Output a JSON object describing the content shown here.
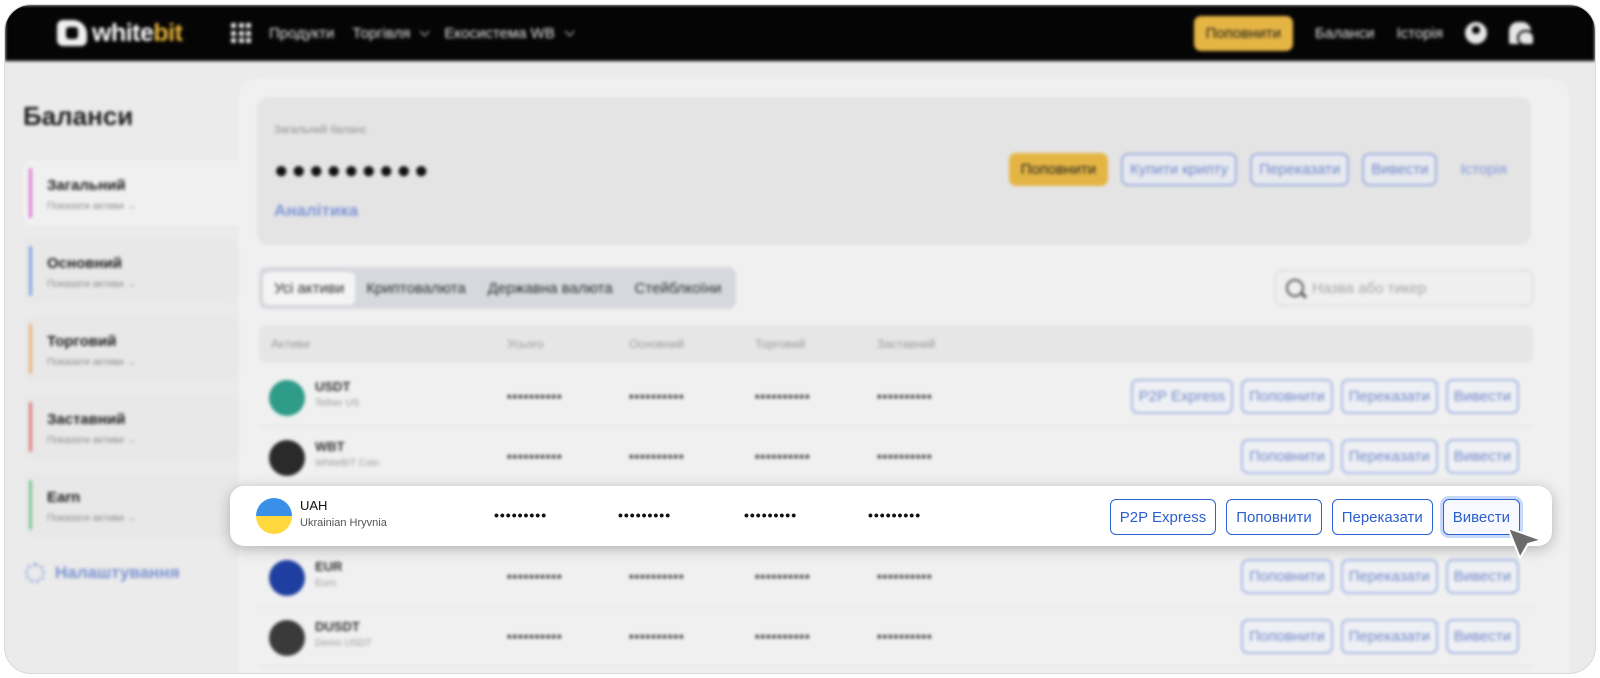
{
  "topbar": {
    "logo_main": "white",
    "logo_accent": "bit",
    "products": "Продукти",
    "trading": "Торгівля",
    "ecosystem": "Екосистема WB",
    "deposit_btn": "Поповнити",
    "balances_link": "Баланси",
    "history_link": "Історія"
  },
  "sidebar": {
    "title": "Баланси",
    "items": [
      {
        "label": "Загальний",
        "sub": "Показати активи →",
        "color": "#e07bd5"
      },
      {
        "label": "Основний",
        "sub": "Показати активи →",
        "color": "#7fa3e6"
      },
      {
        "label": "Торговий",
        "sub": "Показати активи →",
        "color": "#e8b07a"
      },
      {
        "label": "Заставний",
        "sub": "Показати активи →",
        "color": "#e07a7a"
      },
      {
        "label": "Earn",
        "sub": "Показати активи →",
        "color": "#78c78f"
      }
    ],
    "settings": "Налаштування"
  },
  "balance": {
    "label": "Загальний баланс",
    "value": "●●●●●●●●●",
    "analytics": "Аналітика",
    "deposit": "Поповнити",
    "buy": "Купити крипту",
    "transfer": "Переказати",
    "withdraw": "Вивести",
    "history": "Історія"
  },
  "tabs": [
    "Усі активи",
    "Криптовалюта",
    "Державна валюта",
    "Стейблкоїни"
  ],
  "search": {
    "placeholder": "Назва або тикер"
  },
  "table": {
    "headers": [
      "Активи",
      "Усього",
      "Основний",
      "Торговий",
      "Заставний"
    ],
    "mask": "••••••••••",
    "rows": [
      {
        "ticker": "USDT",
        "name": "Tether US",
        "color": "#2e9c88",
        "p2p": true
      },
      {
        "ticker": "WBT",
        "name": "WhiteBIT Coin",
        "color": "#2a2a2a",
        "p2p": false
      },
      {
        "ticker": "UAH",
        "name": "Ukrainian Hryvnia",
        "color": "#3a8fe8",
        "p2p": true
      },
      {
        "ticker": "EUR",
        "name": "Euro",
        "color": "#1f3fa0",
        "p2p": false
      },
      {
        "ticker": "DUSDT",
        "name": "Demo USDT",
        "color": "#3a3a3a",
        "p2p": false
      }
    ],
    "actions": {
      "p2p": "P2P Express",
      "deposit": "Поповнити",
      "transfer": "Переказати",
      "withdraw": "Вивести"
    }
  },
  "focus": {
    "ticker": "UAH",
    "name": "Ukrainian Hryvnia",
    "mask": "•••••••••"
  }
}
